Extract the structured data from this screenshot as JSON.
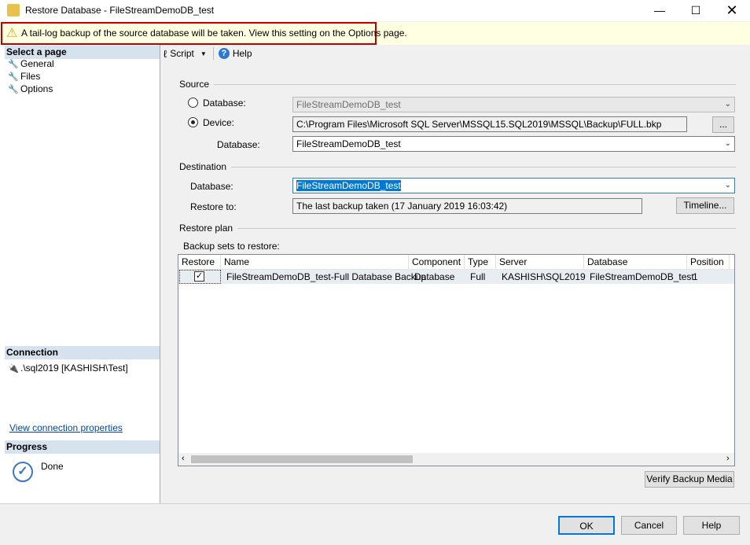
{
  "window": {
    "title": "Restore Database - FileStreamDemoDB_test"
  },
  "warning": "A tail-log backup of the source database will be taken. View this setting on the Options page.",
  "left": {
    "select_page": "Select a page",
    "pages": [
      {
        "label": "General"
      },
      {
        "label": "Files"
      },
      {
        "label": "Options"
      }
    ],
    "connection_header": "Connection",
    "connection": ".\\sql2019 [KASHISH\\Test]",
    "view_connection": "View connection properties",
    "progress_header": "Progress",
    "progress_status": "Done"
  },
  "toolbar": {
    "script": "Script",
    "help": "Help"
  },
  "source": {
    "header": "Source",
    "database_label": "Database:",
    "database_value": "FileStreamDemoDB_test",
    "device_label": "Device:",
    "device_value": "C:\\Program Files\\Microsoft SQL Server\\MSSQL15.SQL2019\\MSSQL\\Backup\\FULL.bkp",
    "browse": "...",
    "device_db_label": "Database:",
    "device_db_value": "FileStreamDemoDB_test"
  },
  "destination": {
    "header": "Destination",
    "database_label": "Database:",
    "database_value": "FileStreamDemoDB_test",
    "restore_to_label": "Restore to:",
    "restore_to_value": "The last backup taken (17 January 2019 16:03:42)",
    "timeline": "Timeline..."
  },
  "plan": {
    "header": "Restore plan",
    "sets_label": "Backup sets to restore:",
    "columns": [
      "Restore",
      "Name",
      "Component",
      "Type",
      "Server",
      "Database",
      "Position"
    ],
    "rows": [
      {
        "restore": true,
        "name": "FileStreamDemoDB_test-Full Database Backup",
        "component": "Database",
        "type": "Full",
        "server": "KASHISH\\SQL2019",
        "database": "FileStreamDemoDB_test",
        "position": "1"
      }
    ],
    "verify": "Verify Backup Media"
  },
  "buttons": {
    "ok": "OK",
    "cancel": "Cancel",
    "help": "Help"
  }
}
